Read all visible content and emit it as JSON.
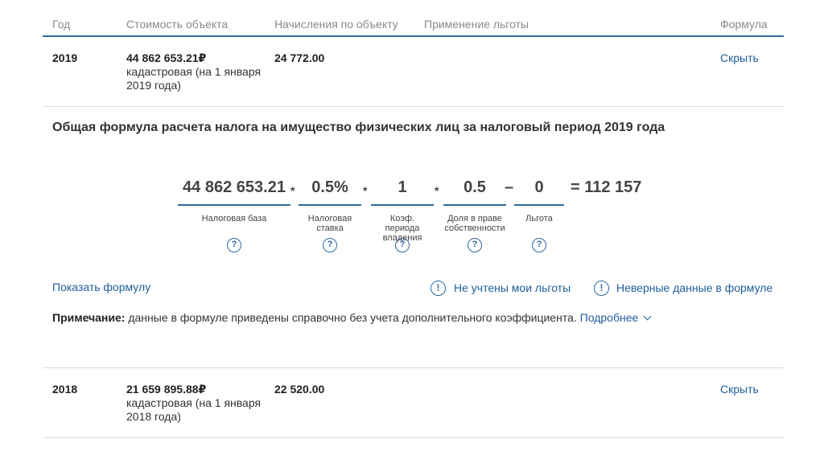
{
  "table": {
    "headers": [
      "Год",
      "Стоимость объекта",
      "Начисления по объекту",
      "Применение льготы",
      "Формула"
    ],
    "rows": [
      {
        "year": "2019",
        "cost_amount": "44 862 653.21₽",
        "cost_note": "кадастровая (на 1 января 2019 года)",
        "accrual": "24 772.00",
        "action": "Скрыть"
      },
      {
        "year": "2018",
        "cost_amount": "21 659 895.88₽",
        "cost_note": "кадастровая (на 1 января 2018 года)",
        "accrual": "22 520.00",
        "action": "Скрыть"
      }
    ]
  },
  "formula": {
    "title": "Общая формула расчета налога на имущество физических лиц за налоговый период 2019 года",
    "terms": [
      {
        "value": "44 862 653.21",
        "label": "Налоговая база"
      },
      {
        "value": "0.5%",
        "label": "Налоговая ставка"
      },
      {
        "value": "1",
        "label": "Коэф. периода владения"
      },
      {
        "value": "0.5",
        "label": "Доля в праве собственности"
      },
      {
        "value": "0",
        "label": "Льгота"
      }
    ],
    "operators": [
      "*",
      "*",
      "*",
      "–"
    ],
    "result": "= 112 157",
    "help_symbol": "?"
  },
  "links": {
    "show_formula": "Показать формулу",
    "benefits_missing": "Не учтены мои льготы",
    "wrong_data": "Неверные данные в формуле",
    "alert_symbol": "!"
  },
  "note": {
    "label": "Примечание:",
    "text": " данные в формуле приведены справочно без учета дополнительного коэффициента.",
    "more": "Подробнее"
  }
}
